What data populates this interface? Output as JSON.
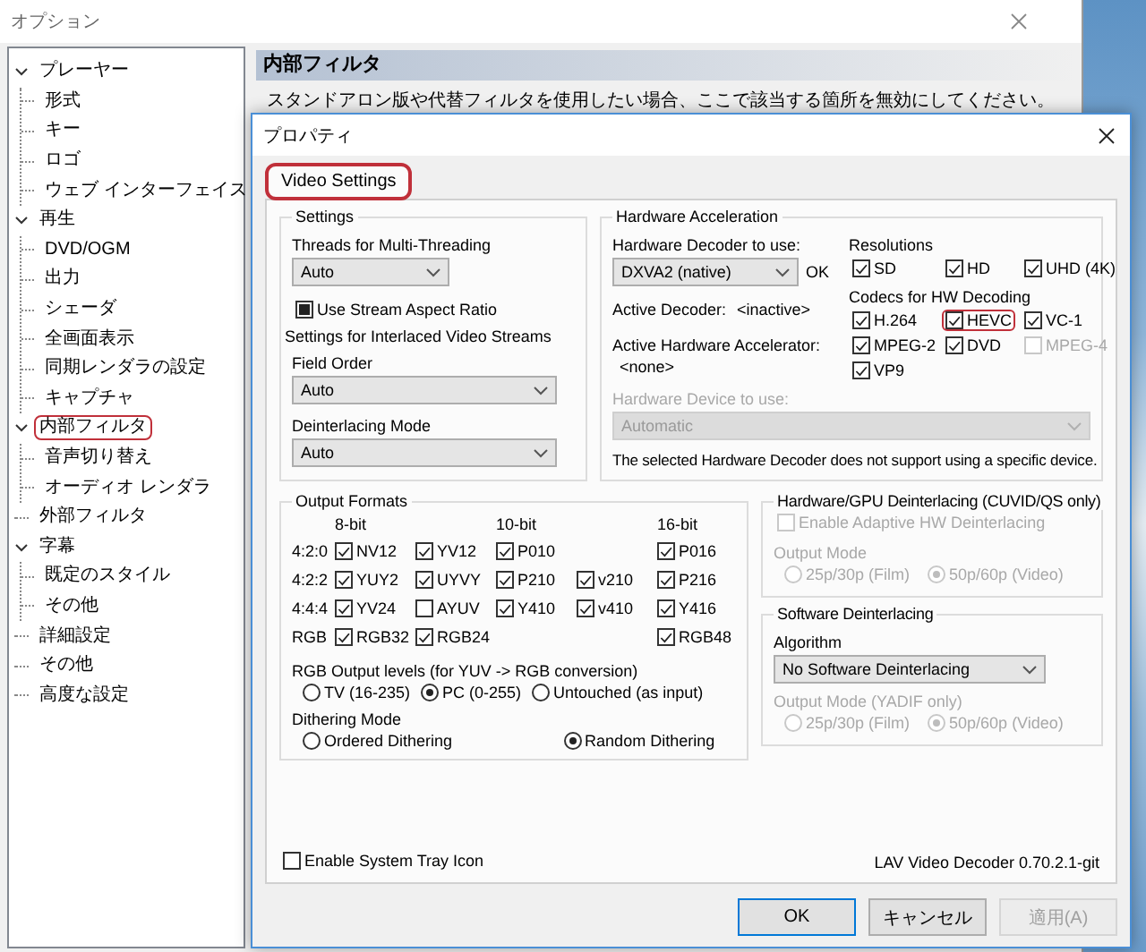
{
  "options_window": {
    "title": "オプション",
    "tree": [
      {
        "label": "プレーヤー",
        "expanded": true,
        "highlighted": false,
        "children": [
          {
            "label": "形式",
            "highlighted": false
          },
          {
            "label": "キー",
            "highlighted": false
          },
          {
            "label": "ロゴ",
            "highlighted": false
          },
          {
            "label": "ウェブ インターフェイス",
            "highlighted": false
          }
        ]
      },
      {
        "label": "再生",
        "expanded": true,
        "highlighted": false,
        "children": [
          {
            "label": "DVD/OGM",
            "highlighted": false
          },
          {
            "label": "出力",
            "highlighted": false
          },
          {
            "label": "シェーダ",
            "highlighted": false
          },
          {
            "label": "全画面表示",
            "highlighted": false
          },
          {
            "label": "同期レンダラの設定",
            "highlighted": false
          },
          {
            "label": "キャプチャ",
            "highlighted": false
          }
        ]
      },
      {
        "label": "内部フィルタ",
        "expanded": true,
        "highlighted": true,
        "children": [
          {
            "label": "音声切り替え",
            "highlighted": false
          },
          {
            "label": "オーディオ レンダラ",
            "highlighted": false
          }
        ]
      },
      {
        "label": "外部フィルタ",
        "highlighted": false
      },
      {
        "label": "字幕",
        "expanded": true,
        "highlighted": false,
        "children": [
          {
            "label": "既定のスタイル",
            "highlighted": false
          },
          {
            "label": "その他",
            "highlighted": false
          }
        ]
      },
      {
        "label": "詳細設定",
        "highlighted": false
      },
      {
        "label": "その他",
        "highlighted": false
      },
      {
        "label": "高度な設定",
        "highlighted": false
      }
    ],
    "page": {
      "heading": "内部フィルタ",
      "description": "スタンドアロン版や代替フィルタを使用したい場合、ここで該当する箇所を無効にしてください。"
    }
  },
  "properties_dialog": {
    "title": "プロパティ",
    "tabs": [
      {
        "label": "Video Settings",
        "selected": true,
        "highlighted": true
      }
    ],
    "settings": {
      "title": "Settings",
      "threads_label": "Threads for Multi-Threading",
      "threads_value": "Auto",
      "stream_aspect": {
        "label": "Use Stream Aspect Ratio",
        "checked": true,
        "indeterminate": true
      },
      "interlaced_title": "Settings for Interlaced Video Streams",
      "field_order_label": "Field Order",
      "field_order_value": "Auto",
      "deint_label": "Deinterlacing Mode",
      "deint_value": "Auto"
    },
    "hw_accel": {
      "title": "Hardware Acceleration",
      "decoder_label": "Hardware Decoder to use:",
      "decoder_value": "DXVA2 (native)",
      "decoder_status": "OK",
      "active_decoder_label": "Active Decoder:",
      "active_decoder_value": "<inactive>",
      "accelerator_label": "Active Hardware Accelerator:",
      "accelerator_value": "<none>",
      "device_label": "Hardware Device to use:",
      "device_value": "Automatic",
      "device_disabled": true,
      "note": "The selected Hardware Decoder does not support using a specific device.",
      "resolutions_title": "Resolutions",
      "resolutions": [
        {
          "label": "SD",
          "checked": true
        },
        {
          "label": "HD",
          "checked": true
        },
        {
          "label": "UHD (4K)",
          "checked": true
        }
      ],
      "codecs_title": "Codecs for HW Decoding",
      "codecs": [
        {
          "label": "H.264",
          "checked": true,
          "disabled": false,
          "highlighted": false
        },
        {
          "label": "HEVC",
          "checked": true,
          "disabled": false,
          "highlighted": true
        },
        {
          "label": "VC-1",
          "checked": true,
          "disabled": false,
          "highlighted": false
        },
        {
          "label": "MPEG-2",
          "checked": true,
          "disabled": false,
          "highlighted": false
        },
        {
          "label": "DVD",
          "checked": true,
          "disabled": false,
          "highlighted": false
        },
        {
          "label": "MPEG-4",
          "checked": false,
          "disabled": true,
          "highlighted": false
        },
        {
          "label": "VP9",
          "checked": true,
          "disabled": false,
          "highlighted": false
        }
      ]
    },
    "output_formats": {
      "title": "Output Formats",
      "column_headers": {
        "column_1": "8-bit",
        "column_3": "10-bit",
        "column_5": "16-bit"
      },
      "rows": [
        {
          "label": "4:2:0",
          "formats": {
            "column_1": {
              "label": "NV12",
              "checked": true
            },
            "column_2": {
              "label": "YV12",
              "checked": true
            },
            "column_3": {
              "label": "P010",
              "checked": true
            },
            "column_5": {
              "label": "P016",
              "checked": true
            }
          }
        },
        {
          "label": "4:2:2",
          "formats": {
            "column_1": {
              "label": "YUY2",
              "checked": true
            },
            "column_2": {
              "label": "UYVY",
              "checked": true
            },
            "column_3": {
              "label": "P210",
              "checked": true
            },
            "column_4": {
              "label": "v210",
              "checked": true
            },
            "column_5": {
              "label": "P216",
              "checked": true
            }
          }
        },
        {
          "label": "4:4:4",
          "formats": {
            "column_1": {
              "label": "YV24",
              "checked": true
            },
            "column_2": {
              "label": "AYUV",
              "checked": false
            },
            "column_3": {
              "label": "Y410",
              "checked": true
            },
            "column_4": {
              "label": "v410",
              "checked": true
            },
            "column_5": {
              "label": "Y416",
              "checked": true
            }
          }
        },
        {
          "label": "RGB",
          "formats": {
            "column_1": {
              "label": "RGB32",
              "checked": true
            },
            "column_2": {
              "label": "RGB24",
              "checked": true
            },
            "column_5": {
              "label": "RGB48",
              "checked": true
            }
          }
        }
      ],
      "rgb_levels_title": "RGB Output levels (for YUV -> RGB conversion)",
      "rgb_levels": [
        {
          "label": "TV (16-235)",
          "selected": false
        },
        {
          "label": "PC (0-255)",
          "selected": true
        },
        {
          "label": "Untouched (as input)",
          "selected": false
        }
      ],
      "dithering_title": "Dithering Mode",
      "dithering": [
        {
          "label": "Ordered Dithering",
          "selected": false
        },
        {
          "label": "Random Dithering",
          "selected": true
        }
      ]
    },
    "hw_deint": {
      "title": "Hardware/GPU Deinterlacing (CUVID/QS only)",
      "enable": {
        "label": "Enable Adaptive HW Deinterlacing",
        "checked": false,
        "disabled": true
      },
      "output_mode_label": "Output Mode",
      "disabled": true,
      "modes": [
        {
          "label": "25p/30p (Film)",
          "selected": false
        },
        {
          "label": "50p/60p (Video)",
          "selected": true
        }
      ]
    },
    "sw_deint": {
      "title": "Software Deinterlacing",
      "algorithm_label": "Algorithm",
      "algorithm_value": "No Software Deinterlacing",
      "output_mode_label": "Output Mode (YADIF only)",
      "disabled": true,
      "modes": [
        {
          "label": "25p/30p (Film)",
          "selected": false
        },
        {
          "label": "50p/60p (Video)",
          "selected": true
        }
      ]
    },
    "tray": {
      "label": "Enable System Tray Icon",
      "checked": false
    },
    "version": "LAV Video Decoder 0.70.2.1-git",
    "buttons": [
      {
        "label": "OK",
        "default": true,
        "disabled": false
      },
      {
        "label": "キャンセル",
        "default": false,
        "disabled": false
      },
      {
        "label": "適用(A)",
        "default": false,
        "disabled": true
      }
    ]
  }
}
